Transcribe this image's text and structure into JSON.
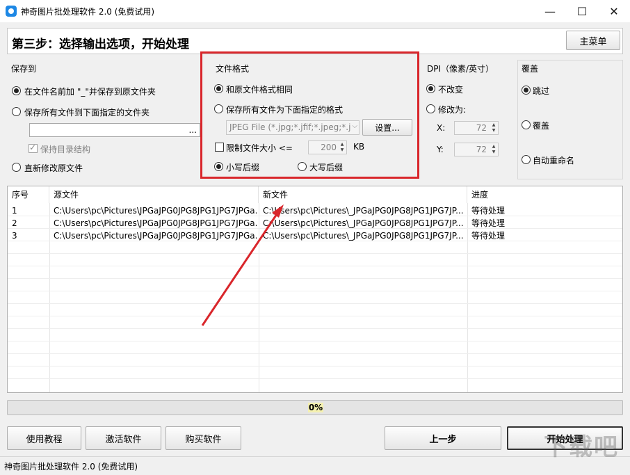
{
  "window": {
    "title": "神奇图片批处理软件 2.0 (免费试用)",
    "minimize": "—",
    "maximize": "☐",
    "close": "✕"
  },
  "header": {
    "step_title": "第三步：选择输出选项，开始处理",
    "main_menu": "主菜单"
  },
  "save_to": {
    "title": "保存到",
    "option_prefix": "在文件名前加 \"_\"并保存到原文件夹",
    "option_folder": "保存所有文件到下面指定的文件夹",
    "folder_browse": "...",
    "keep_structure": "保持目录结构",
    "option_overwrite": "直新修改原文件"
  },
  "file_format": {
    "title": "文件格式",
    "same_format": "和原文件格式相同",
    "save_as_format": "保存所有文件为下面指定的格式",
    "format_value": "JPEG File (*.jpg;*.jfif;*.jpeg;*.j",
    "settings_button": "设置...",
    "limit_size": "限制文件大小 <=",
    "limit_value": "200",
    "limit_unit": "KB",
    "lowercase_ext": "小写后缀",
    "uppercase_ext": "大写后缀"
  },
  "dpi": {
    "title": "DPI（像素/英寸）",
    "unchanged": "不改变",
    "change_to": "修改为:",
    "x_label": "X:",
    "x_value": "72",
    "y_label": "Y:",
    "y_value": "72"
  },
  "overwrite": {
    "title": "覆盖",
    "skip": "跳过",
    "overwrite": "覆盖",
    "auto_rename": "自动重命名"
  },
  "table": {
    "headers": [
      "序号",
      "源文件",
      "新文件",
      "进度"
    ],
    "rows": [
      [
        "1",
        "C:\\Users\\pc\\Pictures\\JPGaJPG0JPG8JPG1JPG7JPGa...",
        "C:\\Users\\pc\\Pictures\\_JPGaJPG0JPG8JPG1JPG7JP...",
        "等待处理"
      ],
      [
        "2",
        "C:\\Users\\pc\\Pictures\\JPGaJPG0JPG8JPG1JPG7JPGa...",
        "C:\\Users\\pc\\Pictures\\_JPGaJPG0JPG8JPG1JPG7JP...",
        "等待处理"
      ],
      [
        "3",
        "C:\\Users\\pc\\Pictures\\JPGaJPG0JPG8JPG1JPG7JPGa...",
        "C:\\Users\\pc\\Pictures\\_JPGaJPG0JPG8JPG1JPG7JP...",
        "等待处理"
      ]
    ]
  },
  "progress": {
    "text": "0%",
    "value": 0
  },
  "footer": {
    "tutorial": "使用教程",
    "activate": "激活软件",
    "buy": "购买软件",
    "prev": "上一步",
    "start": "开始处理"
  },
  "status_bar": {
    "text": "神奇图片批处理软件 2.0 (免费试用)"
  },
  "watermark": "下载吧",
  "colors": {
    "highlight": "#d9262b",
    "arrow": "#d9262b"
  }
}
